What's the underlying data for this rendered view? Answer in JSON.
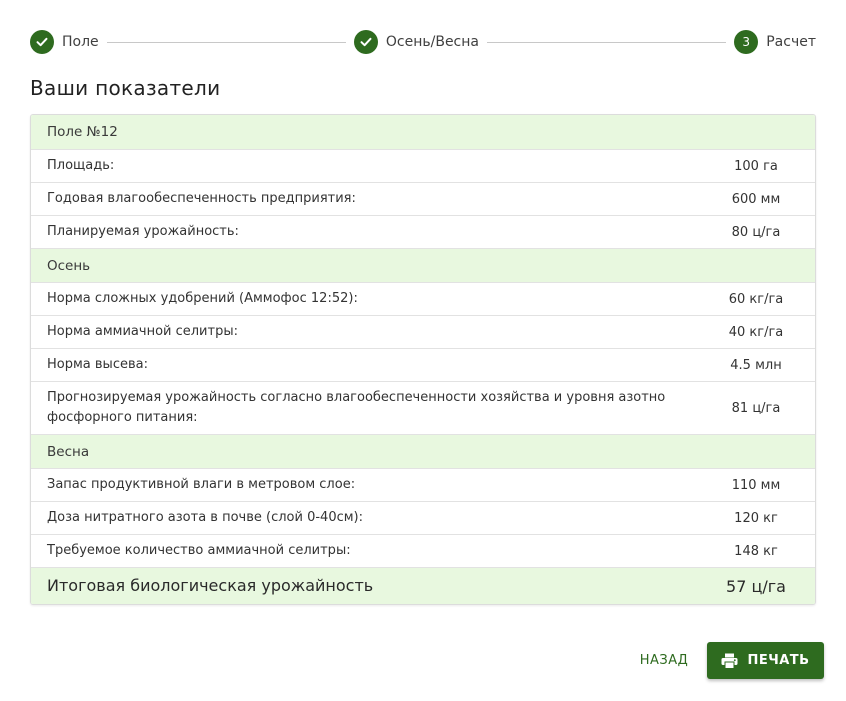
{
  "stepper": {
    "steps": [
      {
        "label": "Поле",
        "state": "done",
        "icon": "check-icon"
      },
      {
        "label": "Осень/Весна",
        "state": "done",
        "icon": "check-icon"
      },
      {
        "label": "Расчет",
        "state": "active",
        "number": "3"
      }
    ]
  },
  "title": "Ваши показатели",
  "table": {
    "field": {
      "header": "Поле №12",
      "rows": [
        {
          "label": "Площадь:",
          "value": "100 га"
        },
        {
          "label": "Годовая влагообеспеченность предприятия:",
          "value": "600 мм"
        },
        {
          "label": "Планируемая урожайность:",
          "value": "80 ц/га"
        }
      ]
    },
    "autumn": {
      "header": "Осень",
      "rows": [
        {
          "label": "Норма сложных удобрений (Аммофос 12:52):",
          "value": "60 кг/га"
        },
        {
          "label": "Норма аммиачной селитры:",
          "value": "40 кг/га"
        },
        {
          "label": "Норма высева:",
          "value": "4.5 млн"
        },
        {
          "label": "Прогнозируемая урожайность согласно влагообеспеченности хозяйства и уровня азотно фосфорного питания:",
          "value": "81 ц/га"
        }
      ]
    },
    "spring": {
      "header": "Весна",
      "rows": [
        {
          "label": "Запас продуктивной влаги в метровом слое:",
          "value": "110 мм"
        },
        {
          "label": "Доза нитратного азота в почве (слой 0-40см):",
          "value": "120 кг"
        },
        {
          "label": "Требуемое количество аммиачной селитры:",
          "value": "148 кг"
        }
      ]
    },
    "total": {
      "label": "Итоговая биологическая урожайность",
      "value": "57 ц/га"
    }
  },
  "buttons": {
    "back": "НАЗАД",
    "print": "ПЕЧАТЬ",
    "print_icon": "printer-icon"
  },
  "colors": {
    "accent": "#2e6b1f",
    "section_bg": "#e8f8df",
    "border": "#dcdcdc"
  }
}
